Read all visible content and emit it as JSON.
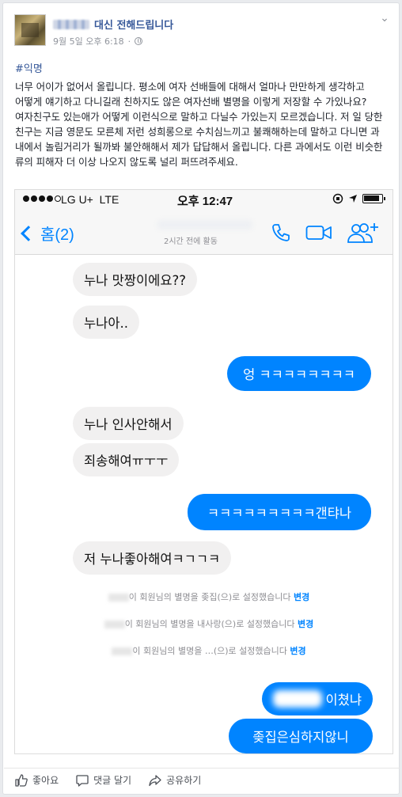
{
  "post": {
    "page_name": "대신 전해드립니다",
    "timestamp": "9월 5일 오후 6:18",
    "hashtag": "#익명",
    "body": "너무 어이가 없어서 올립니다. 평소에 여자 선배들에 대해서 얼마나 만만하게 생각하고 어떻게 얘기하고 다니길래 친하지도 않은 여자선배 별명을 이렇게 저장할 수 가있나요? 여자친구도 있는애가 어떻게 이런식으로 말하고 다닐수 가있는지 모르겠습니다. 저 일 당한 친구는 지금 영문도 모른체 저런 성희롱으로 수치심느끼고 불쾌해하는데 말하고 다니면 과 내에서 놀림거리가 될까봐 불안해해서 제가 답답해서 올립니다. 다른 과에서도 이런 비슷한 류의 피해자 더 이상 나오지 않도록 널리 퍼뜨려주세요."
  },
  "phone": {
    "status": {
      "carrier": "LG U+",
      "network": "LTE",
      "time": "오후 12:47"
    },
    "nav": {
      "back_label": "홈(2)",
      "active_status": "2시간 전에 활동"
    },
    "messages": [
      {
        "side": "in",
        "text": "누나 맛짱이에요??"
      },
      {
        "side": "in",
        "text": "누나아.."
      },
      {
        "side": "out",
        "text": "엉 ㅋㅋㅋㅋㅋㅋㅋㅋ"
      },
      {
        "side": "in",
        "text": "누나 인사안해서"
      },
      {
        "side": "in",
        "text": "죄송해여ㅠㅜㅜ"
      },
      {
        "side": "out",
        "text": "ㅋㅋㅋㅋㅋㅋㅋㅋㅋ갠탸나"
      },
      {
        "side": "in",
        "text": "저 누나좋아해여ㅋㄱㄱㅋ"
      },
      {
        "side": "out",
        "text": "이쳤냐"
      },
      {
        "side": "out",
        "text": "좆집은심하지않니"
      }
    ],
    "system_notes": [
      {
        "text": "이 회원님의 별명을 좆집(으)로 설정했습니다",
        "link": "변경"
      },
      {
        "text": "이 회원님의 별명을 내사랑(으)로 설정했습니다",
        "link": "변경"
      },
      {
        "text": "이 회원님의 별명을 …(으)로 설정했습니다",
        "link": "변경"
      }
    ]
  },
  "actions": {
    "like": "좋아요",
    "comment": "댓글 달기",
    "share": "공유하기"
  },
  "colors": {
    "link": "#365899",
    "messenger_blue": "#0084ff",
    "bubble_grey": "#f1f0f0"
  }
}
